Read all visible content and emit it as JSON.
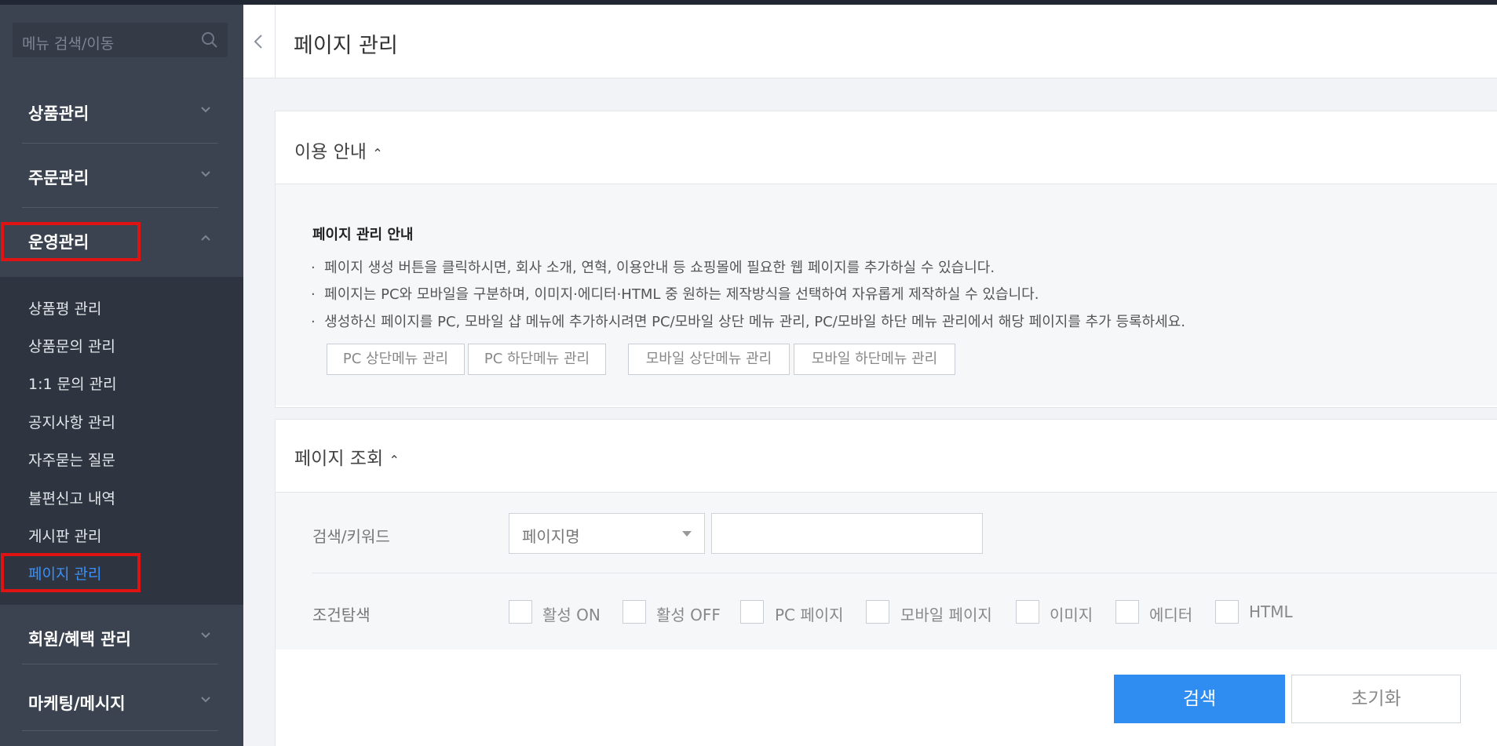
{
  "sidebar": {
    "search_placeholder": "메뉴 검색/이동",
    "items": [
      {
        "label": "상품관리"
      },
      {
        "label": "주문관리"
      },
      {
        "label": "운영관리"
      },
      {
        "label": "회원/혜택 관리"
      },
      {
        "label": "마케팅/메시지"
      }
    ],
    "submenu": [
      {
        "label": "상품평 관리"
      },
      {
        "label": "상품문의 관리"
      },
      {
        "label": "1:1 문의 관리"
      },
      {
        "label": "공지사항 관리"
      },
      {
        "label": "자주묻는 질문"
      },
      {
        "label": "불편신고 내역"
      },
      {
        "label": "게시판 관리"
      },
      {
        "label": "페이지 관리"
      }
    ]
  },
  "header": {
    "title": "페이지 관리"
  },
  "guide": {
    "title": "이용 안내",
    "heading": "페이지 관리 안내",
    "bullets": [
      "페이지 생성 버튼을 클릭하시면, 회사 소개, 연혁, 이용안내 등 쇼핑몰에 필요한 웹 페이지를 추가하실 수 있습니다.",
      "페이지는 PC와 모바일을 구분하며, 이미지·에디터·HTML 중 원하는 제작방식을 선택하여 자유롭게 제작하실 수 있습니다.",
      "생성하신 페이지를 PC, 모바일 샵 메뉴에 추가하시려면 PC/모바일 상단 메뉴 관리, PC/모바일 하단 메뉴 관리에서 해당 페이지를 추가 등록하세요."
    ],
    "buttons": [
      "PC 상단메뉴 관리",
      "PC 하단메뉴 관리",
      "모바일 상단메뉴 관리",
      "모바일 하단메뉴 관리"
    ]
  },
  "search": {
    "title": "페이지 조회",
    "keyword_label": "검색/키워드",
    "select_value": "페이지명",
    "keyword_value": "",
    "condition_label": "조건탐색",
    "checkboxes": [
      "활성 ON",
      "활성 OFF",
      "PC 페이지",
      "모바일 페이지",
      "이미지",
      "에디터",
      "HTML"
    ]
  },
  "actions": {
    "search": "검색",
    "reset": "초기화"
  },
  "colors": {
    "accent": "#2f8cf0",
    "highlight": "#e01313",
    "sidebar": "#3b4350"
  }
}
